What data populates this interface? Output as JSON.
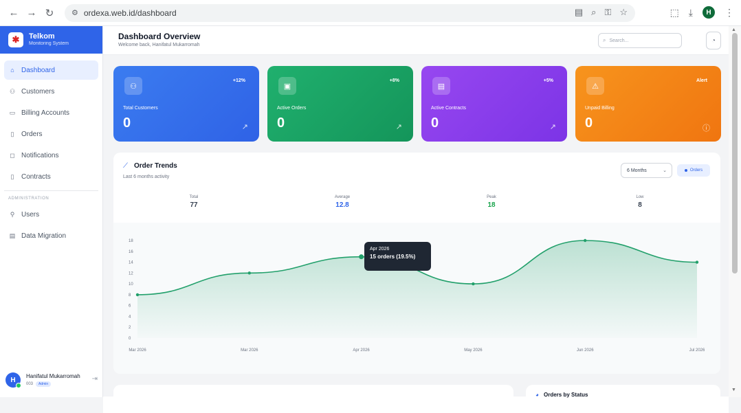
{
  "browser": {
    "url": "ordexa.web.id/dashboard",
    "profile_initial": "H"
  },
  "brand": {
    "name": "Telkom",
    "subtitle": "Monitoring System"
  },
  "sidebar": {
    "items": [
      {
        "label": "Dashboard",
        "icon": "home-icon",
        "active": true
      },
      {
        "label": "Customers",
        "icon": "users-icon",
        "active": false
      },
      {
        "label": "Billing Accounts",
        "icon": "credit-card-icon",
        "active": false
      },
      {
        "label": "Orders",
        "icon": "file-icon",
        "active": false
      },
      {
        "label": "Notifications",
        "icon": "bell-icon",
        "active": false
      },
      {
        "label": "Contracts",
        "icon": "document-icon",
        "active": false
      }
    ],
    "admin_section": "ADMINISTRATION",
    "admin_items": [
      {
        "label": "Users",
        "icon": "user-icon"
      },
      {
        "label": "Data Migration",
        "icon": "database-icon"
      }
    ],
    "user": {
      "initial": "H",
      "name": "Hanifatul Mukarromah",
      "id": "003",
      "role": "Admin"
    }
  },
  "header": {
    "title": "Dashboard Overview",
    "subtitle": "Welcome back, Hanifatul Mukarromah",
    "search_placeholder": "Search..."
  },
  "cards": [
    {
      "label": "Total Customers",
      "value": "0",
      "badge": "+12%",
      "icon": "users-icon",
      "color": "#2f62e6"
    },
    {
      "label": "Active Orders",
      "value": "0",
      "badge": "+8%",
      "icon": "file-icon",
      "color": "#14955a"
    },
    {
      "label": "Active Contracts",
      "value": "0",
      "badge": "+5%",
      "icon": "document-icon",
      "color": "#7c34e6"
    },
    {
      "label": "Unpaid Billing",
      "value": "0",
      "badge": "Alert",
      "icon": "alert-icon",
      "color": "#f07510"
    }
  ],
  "trends": {
    "title": "Order Trends",
    "subtitle": "Last 6 months activity",
    "range": "6 Months",
    "legend": "Orders",
    "stats": [
      {
        "label": "Total",
        "value": "77",
        "color": "#374151"
      },
      {
        "label": "Average",
        "value": "12.8",
        "color": "#2f64e8"
      },
      {
        "label": "Peak",
        "value": "18",
        "color": "#16a34a"
      },
      {
        "label": "Low",
        "value": "8",
        "color": "#374151"
      }
    ],
    "tooltip": {
      "title": "Apr 2026",
      "value": "15 orders (19.5%)"
    }
  },
  "chart_data": {
    "type": "area",
    "x": [
      "Mar 2026",
      "Mar 2026",
      "Apr 2026",
      "May 2026",
      "Jun 2026",
      "Jul 2026"
    ],
    "series": [
      {
        "name": "Orders",
        "values": [
          8,
          12,
          15,
          10,
          18,
          14
        ],
        "color": "#22a06b"
      }
    ],
    "y_ticks": [
      0,
      2,
      4,
      6,
      8,
      10,
      12,
      14,
      16,
      18
    ],
    "ylim": [
      0,
      18
    ],
    "grid": false
  },
  "bottom": {
    "right_title": "Orders by Status"
  }
}
